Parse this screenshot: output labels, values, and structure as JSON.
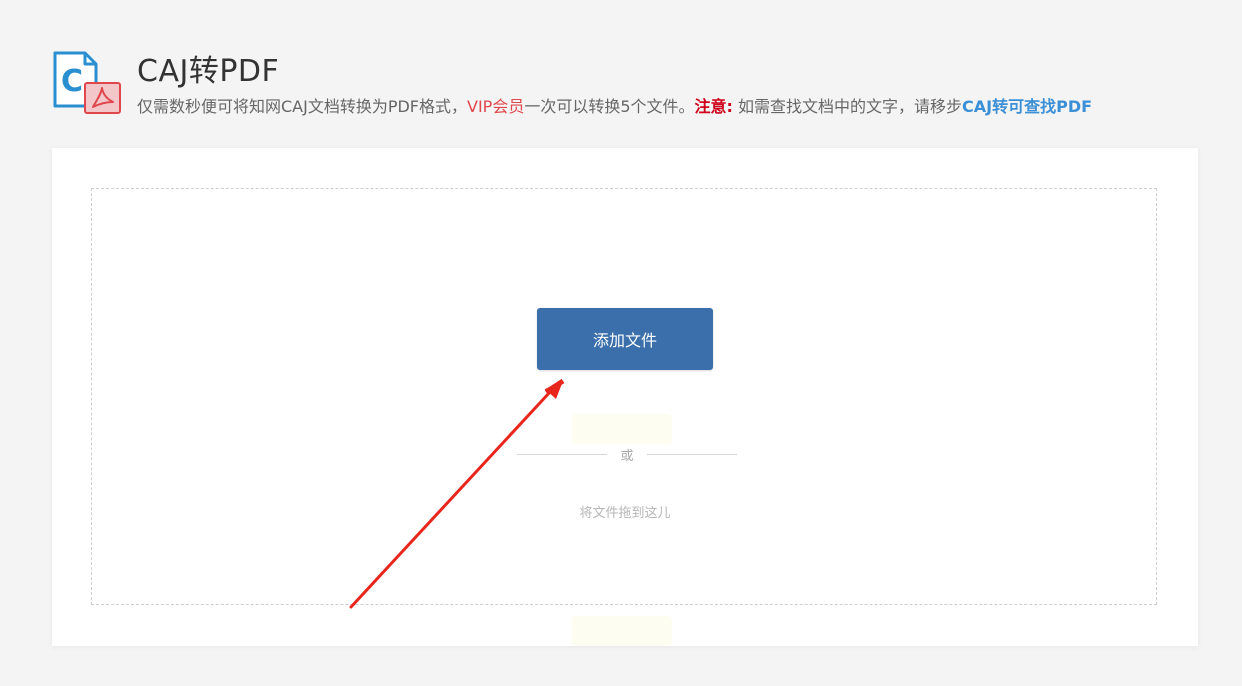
{
  "header": {
    "title": "CAJ转PDF",
    "logo_letter": "C",
    "subtitle": {
      "part1": "仅需数秒便可将知网CAJ文档转换为PDF格式，",
      "vip": "VIP会员",
      "part2": "一次可以转换5个文件。",
      "note_label": "注意:",
      "part3": " 如需查找文档中的文字，请移步",
      "link": "CAJ转可查找PDF"
    }
  },
  "upload": {
    "add_button_label": "添加文件",
    "or_label": "或",
    "drag_hint": "将文件拖到这儿"
  },
  "colors": {
    "button_bg": "#3a6fab",
    "vip": "#e0474c",
    "note": "#d0021b",
    "link": "#3b8fd6",
    "arrow": "#e8261c"
  }
}
